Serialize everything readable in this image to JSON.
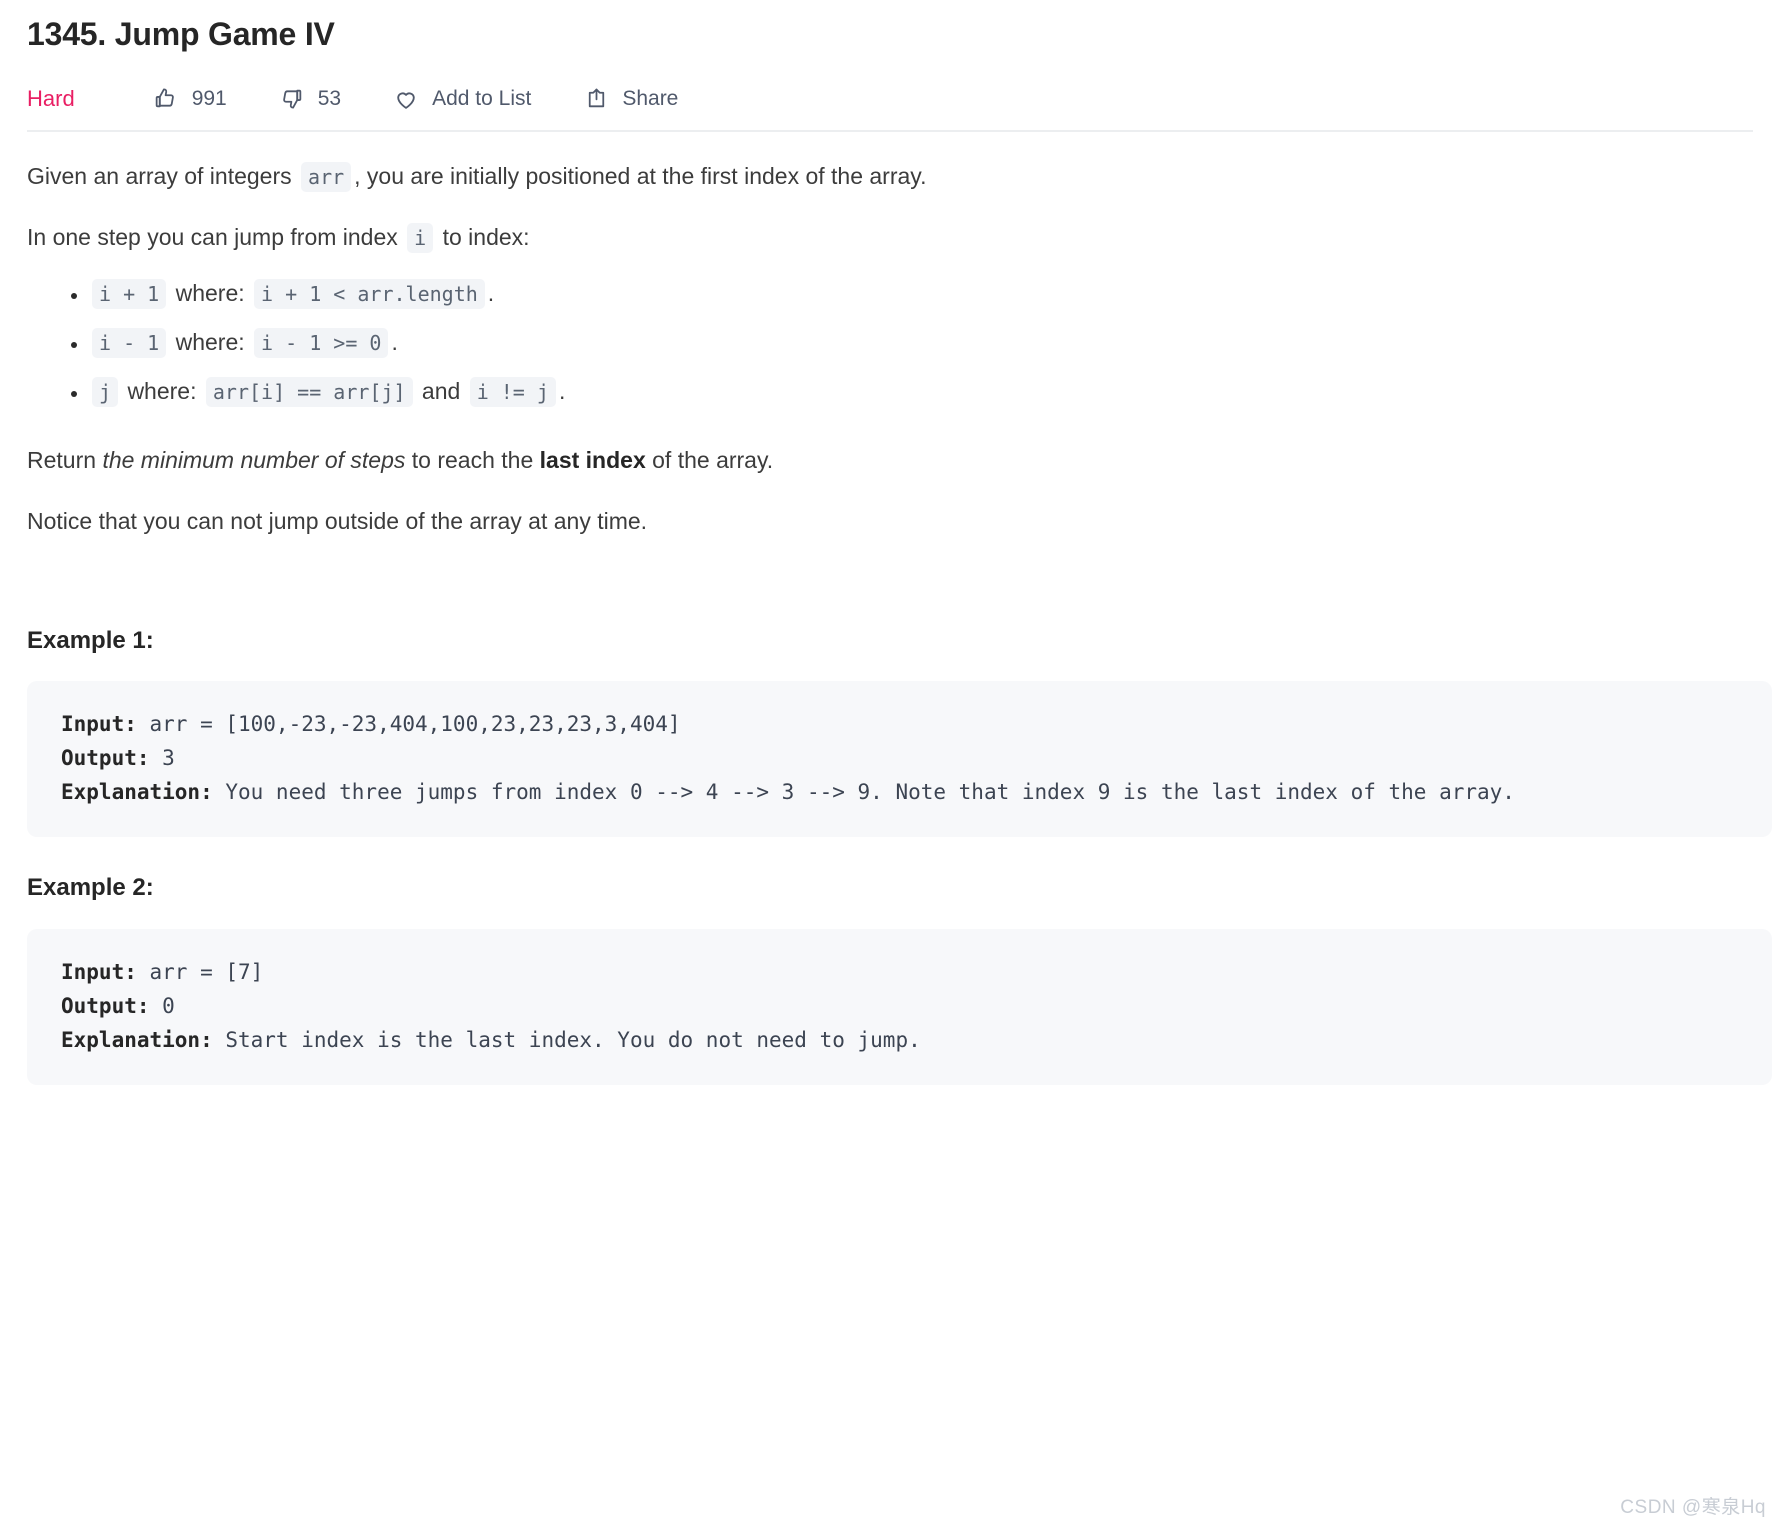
{
  "problem": {
    "title": "1345. Jump Game IV",
    "difficulty": "Hard",
    "difficulty_color": "#e91e63"
  },
  "actions": {
    "likes": "991",
    "dislikes": "53",
    "add_to_list": "Add to List",
    "share": "Share"
  },
  "description": {
    "p1_a": "Given an array of integers",
    "p1_code": "arr",
    "p1_b": ", you are initially positioned at the first index of the array.",
    "p2_a": "In one step you can jump from index",
    "p2_code": "i",
    "p2_b": "to index:",
    "rules": [
      {
        "code1": "i + 1",
        "mid": "where:",
        "code2": "i + 1 < arr.length",
        "tail": "."
      },
      {
        "code1": "i - 1",
        "mid": "where:",
        "code2": "i - 1 >= 0",
        "tail": "."
      },
      {
        "code1": "j",
        "mid": "where:",
        "code2": "arr[i] == arr[j]",
        "mid2": "and",
        "code3": "i != j",
        "tail": "."
      }
    ],
    "p3_a": "Return",
    "p3_italic": "the minimum number of steps",
    "p3_b": "to reach the",
    "p3_bold": "last index",
    "p3_c": "of the array.",
    "p4": "Notice that you can not jump outside of the array at any time."
  },
  "examples": [
    {
      "heading": "Example 1:",
      "input_label": "Input:",
      "input_value": " arr = [100,-23,-23,404,100,23,23,23,3,404]",
      "output_label": "Output:",
      "output_value": " 3",
      "explanation_label": "Explanation:",
      "explanation_value": " You need three jumps from index 0 --> 4 --> 3 --> 9. Note that index 9 is the last index of the array."
    },
    {
      "heading": "Example 2:",
      "input_label": "Input:",
      "input_value": " arr = [7]",
      "output_label": "Output:",
      "output_value": " 0",
      "explanation_label": "Explanation:",
      "explanation_value": " Start index is the last index. You do not need to jump."
    }
  ],
  "watermark": "CSDN @寒泉Hq"
}
